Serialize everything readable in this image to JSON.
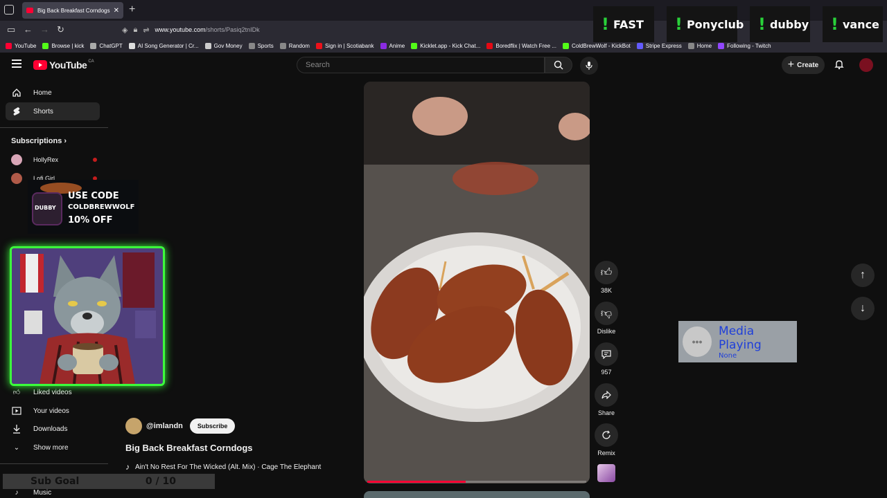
{
  "browser": {
    "tab_title": "Big Back Breakfast Corndogs - Y",
    "url_host": "www.youtube.com",
    "url_path": "/shorts/Pasiq2tnIDk",
    "bookmarks": [
      {
        "label": "YouTube",
        "color": "#ff0033"
      },
      {
        "label": "Browse | kick",
        "color": "#53fc18"
      },
      {
        "label": "ChatGPT",
        "color": "#aaaaaa"
      },
      {
        "label": "AI Song Generator | Cr...",
        "color": "#dddddd"
      },
      {
        "label": "Gov Money",
        "color": "#cccccc"
      },
      {
        "label": "Sports",
        "color": "#888888"
      },
      {
        "label": "Random",
        "color": "#888888"
      },
      {
        "label": "Sign in | Scotiabank",
        "color": "#ec111a"
      },
      {
        "label": "Anime",
        "color": "#8a2be2"
      },
      {
        "label": "Kicklet.app - Kick Chat...",
        "color": "#53fc18"
      },
      {
        "label": "Boredflix | Watch Free ...",
        "color": "#e50914"
      },
      {
        "label": "ColdBrewWolf - KickBot",
        "color": "#53fc18"
      },
      {
        "label": "Stripe Express",
        "color": "#635bff"
      },
      {
        "label": "Home",
        "color": "#888888"
      },
      {
        "label": "Following - Twitch",
        "color": "#9146ff"
      }
    ]
  },
  "stream_badges": [
    "FAST",
    "Ponyclub",
    "dubby",
    "vance"
  ],
  "header": {
    "logo_text": "YouTube",
    "country": "CA",
    "search_placeholder": "Search",
    "create_label": "Create"
  },
  "sidebar": {
    "home": "Home",
    "shorts": "Shorts",
    "subscriptions_heading": "Subscriptions",
    "subscriptions": [
      {
        "name": "HollyRex",
        "color": "#d9a6b7"
      },
      {
        "name": "Lofi Girl",
        "color": "#b05a48"
      }
    ],
    "liked": "Liked videos",
    "your_videos": "Your videos",
    "downloads": "Downloads",
    "show_more": "Show more",
    "music": "Music"
  },
  "overlay": {
    "promo_line1": "USE CODE",
    "promo_line2": "COLDBREWWOLF",
    "promo_line3": "10% OFF",
    "promo_can": "DUBBY",
    "sub_goal_label": "Sub Goal",
    "sub_goal_value": "0 / 10"
  },
  "short": {
    "channel": "@imlandn",
    "subscribe": "Subscribe",
    "title": "Big Back Breakfast Corndogs",
    "song": "Ain't No Rest For The Wicked (Alt. Mix) · Cage The Elephant",
    "progress": 0.45,
    "likes": "38K",
    "dislike": "Dislike",
    "comments": "957",
    "share": "Share",
    "remix": "Remix"
  },
  "media_widget": {
    "title": "Media Playing",
    "subtitle": "None"
  }
}
